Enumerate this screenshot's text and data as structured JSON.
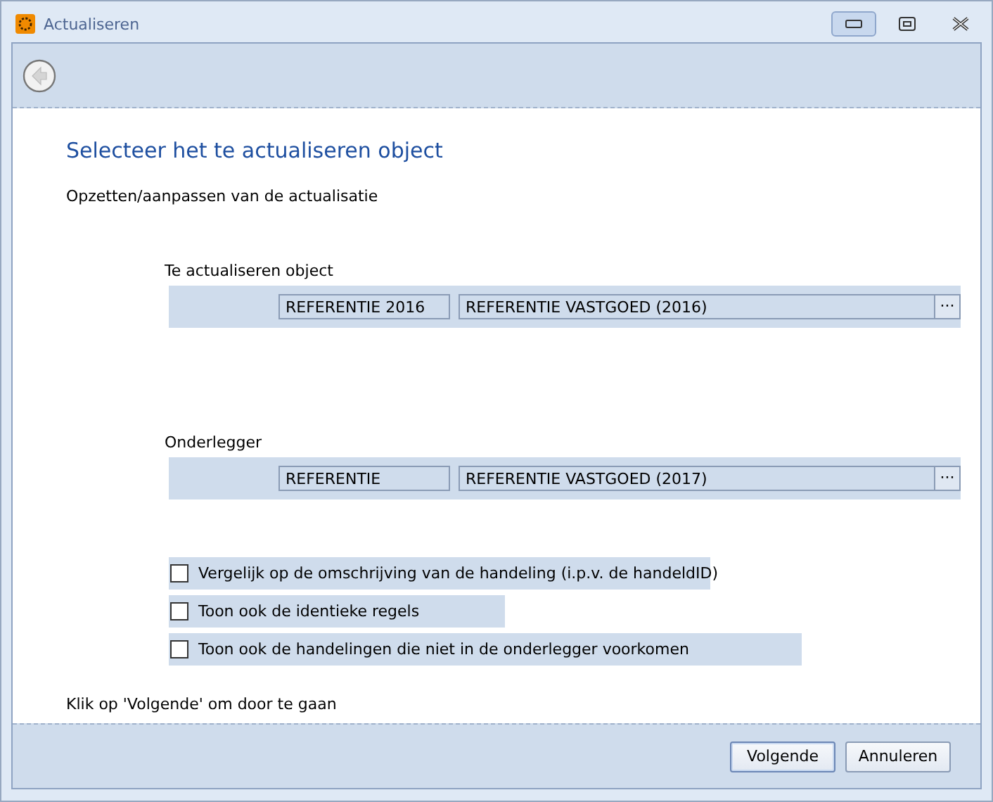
{
  "window": {
    "title": "Actualiseren"
  },
  "heading": "Selecteer het te actualiseren object",
  "subtitle": "Opzetten/aanpassen van de actualisatie",
  "lookups": [
    {
      "label": "Te actualiseren object",
      "code": "REFERENTIE 2016",
      "name": "REFERENTIE VASTGOED (2016)",
      "button": "···"
    },
    {
      "label": "Onderlegger",
      "code": "REFERENTIE",
      "name": "REFERENTIE VASTGOED (2017)",
      "button": "···"
    }
  ],
  "options": [
    {
      "label": "Vergelijk op de omschrijving van de handeling (i.p.v. de handeldID)",
      "checked": false
    },
    {
      "label": "Toon ook de identieke regels",
      "checked": false
    },
    {
      "label": "Toon ook de handelingen die niet in de onderlegger voorkomen",
      "checked": false
    }
  ],
  "hint": "Klik op 'Volgende' om door te gaan",
  "buttons": [
    "Volgende",
    "Annuleren"
  ]
}
